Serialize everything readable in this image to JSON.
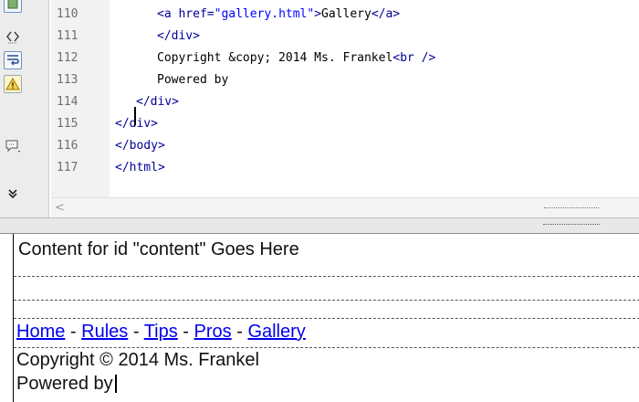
{
  "code_view": {
    "line_numbers": [
      "110",
      "111",
      "112",
      "113",
      "114",
      "115",
      "116",
      "117"
    ],
    "lines": {
      "l110": {
        "open": "<a",
        "attr": " href=",
        "val": "\"gallery.html\"",
        "close": ">",
        "text": "Gallery",
        "end": "</a>"
      },
      "l111": {
        "tag": "</div>"
      },
      "l112": {
        "text": "Copyright &copy; 2014 Ms. Frankel",
        "tag": "<br />"
      },
      "l113": {
        "text": "Powered by"
      },
      "l114": {
        "tag": "</div>"
      },
      "l115": {
        "tag": "</div>"
      },
      "l116": {
        "tag": "</body>"
      },
      "l117": {
        "tag": "</html>"
      }
    },
    "toolbar_icons": [
      "format-icon",
      "code-navigation-icon",
      "word-wrap-icon",
      "syntax-warning-icon",
      "comment-icon",
      "more-options-icon"
    ],
    "scroll_left_glyph": "<"
  },
  "design_view": {
    "content_placeholder": "Content for id \"content\" Goes Here",
    "nav_links": [
      "Home",
      "Rules",
      "Tips",
      "Pros",
      "Gallery"
    ],
    "nav_separator": " - ",
    "copyright": "Copyright © 2014 Ms. Frankel",
    "powered_by": "Powered by"
  }
}
